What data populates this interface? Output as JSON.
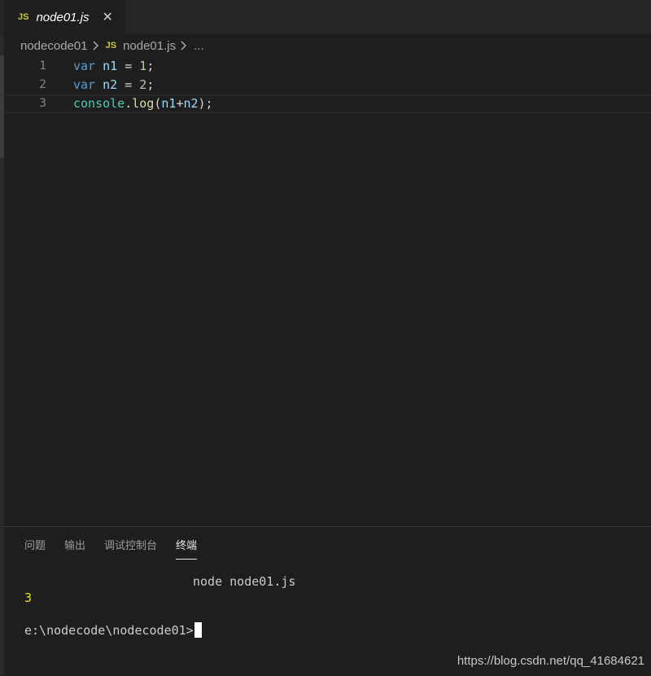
{
  "tab": {
    "lang_icon": "JS",
    "label": "node01.js",
    "close_glyph": "✕"
  },
  "breadcrumb": {
    "folder": "nodecode01",
    "file_icon": "JS",
    "file": "node01.js",
    "more": "..."
  },
  "code": {
    "lines": [
      {
        "number": "1",
        "tokens": [
          "var",
          " ",
          "n1",
          " = ",
          "1",
          ";"
        ]
      },
      {
        "number": "2",
        "tokens": [
          "var",
          " ",
          "n2",
          " = ",
          "2",
          ";"
        ]
      },
      {
        "number": "3",
        "tokens": [
          "console",
          ".",
          "log",
          "(",
          "n1",
          "+",
          "n2",
          ");"
        ]
      }
    ]
  },
  "panel": {
    "tabs": [
      "问题",
      "输出",
      "调试控制台",
      "终端"
    ],
    "active_tab": "终端",
    "terminal": {
      "command": "node node01.js",
      "output": "3",
      "prompt": "e:\\nodecode\\nodecode01>"
    }
  },
  "watermark": "https://blog.csdn.net/qq_41684621",
  "colors": {
    "editor_bg": "#1e1e1e",
    "keyword": "#569cd6",
    "variable": "#9cdcfe",
    "number": "#b5cea8",
    "class": "#4ec9b0",
    "function": "#dcdcaa",
    "js_icon": "#cbcb41",
    "terminal_output": "#e5e510"
  }
}
